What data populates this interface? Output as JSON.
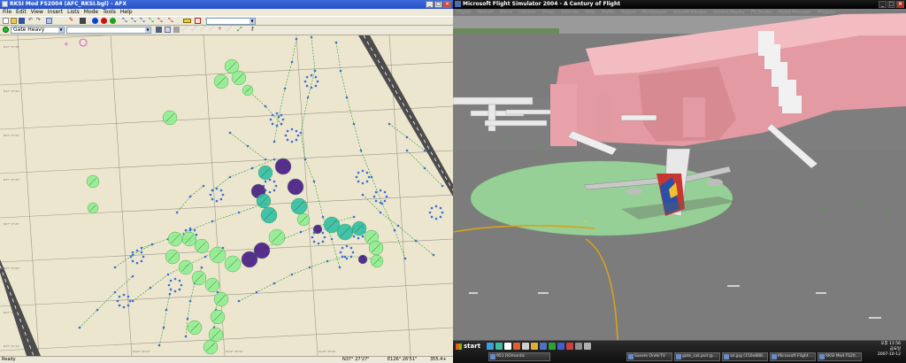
{
  "afx": {
    "title": "RKSI Mod FS2004 (AFC_RKSI.bgl) - AFX",
    "menu": [
      "File",
      "Edit",
      "View",
      "Insert",
      "Lists",
      "Mode",
      "Tools",
      "Help"
    ],
    "parking_type_select": "Gate Heavy",
    "status": {
      "ready": "Ready",
      "latitude": "N37° 27'27\"",
      "longitude": "E126° 26'51\"",
      "zoom": "355.4+"
    },
    "grid_labels": {
      "lat": [
        "N37° 27'45\"",
        "N37° 27'40\"",
        "N37° 27'35\"",
        "N37° 27'30\"",
        "N37° 27'25\"",
        "N37° 27'20\"",
        "N37° 27'15\"",
        "N37° 27'10\""
      ],
      "lon": [
        "E126° 26'20\"",
        "E126° 26'30\"",
        "E126° 26'40\""
      ]
    }
  },
  "fs": {
    "title": "Microsoft Flight Simulator 2004 - A Century of Flight",
    "menu": [
      "Flights",
      "Aircraft",
      "World",
      "Options",
      "Views",
      "Vehicles",
      "Help",
      "Traffic",
      "Airport",
      "Multiplayer",
      "Aircraft Hangar",
      "Instant Replay",
      "FS Studio",
      "Afcad Manager",
      "Modules"
    ]
  },
  "taskbar": {
    "start_label": "start",
    "tasks": [
      "951 ROmantic",
      "Sasem OnAirTV",
      "gate_cat.psd @...",
      "air.jpg (150x888...",
      "Microsoft Flight ...",
      "RKSI Mod FS20..."
    ],
    "clock_time": "오후 11:56",
    "clock_day": "금요일",
    "clock_date": "2007-10-12"
  },
  "colors": {
    "parking_green": "#90ee90",
    "parking_teal": "#2fbfa5",
    "parking_purple": "#4a1a8a",
    "taxi_node": "#3a6fd0",
    "taxi_link": "#2a9a2a",
    "map_bg": "#ece6cf",
    "apron_green": "#8fce8f",
    "terminal_pink": "#eeaab0"
  }
}
